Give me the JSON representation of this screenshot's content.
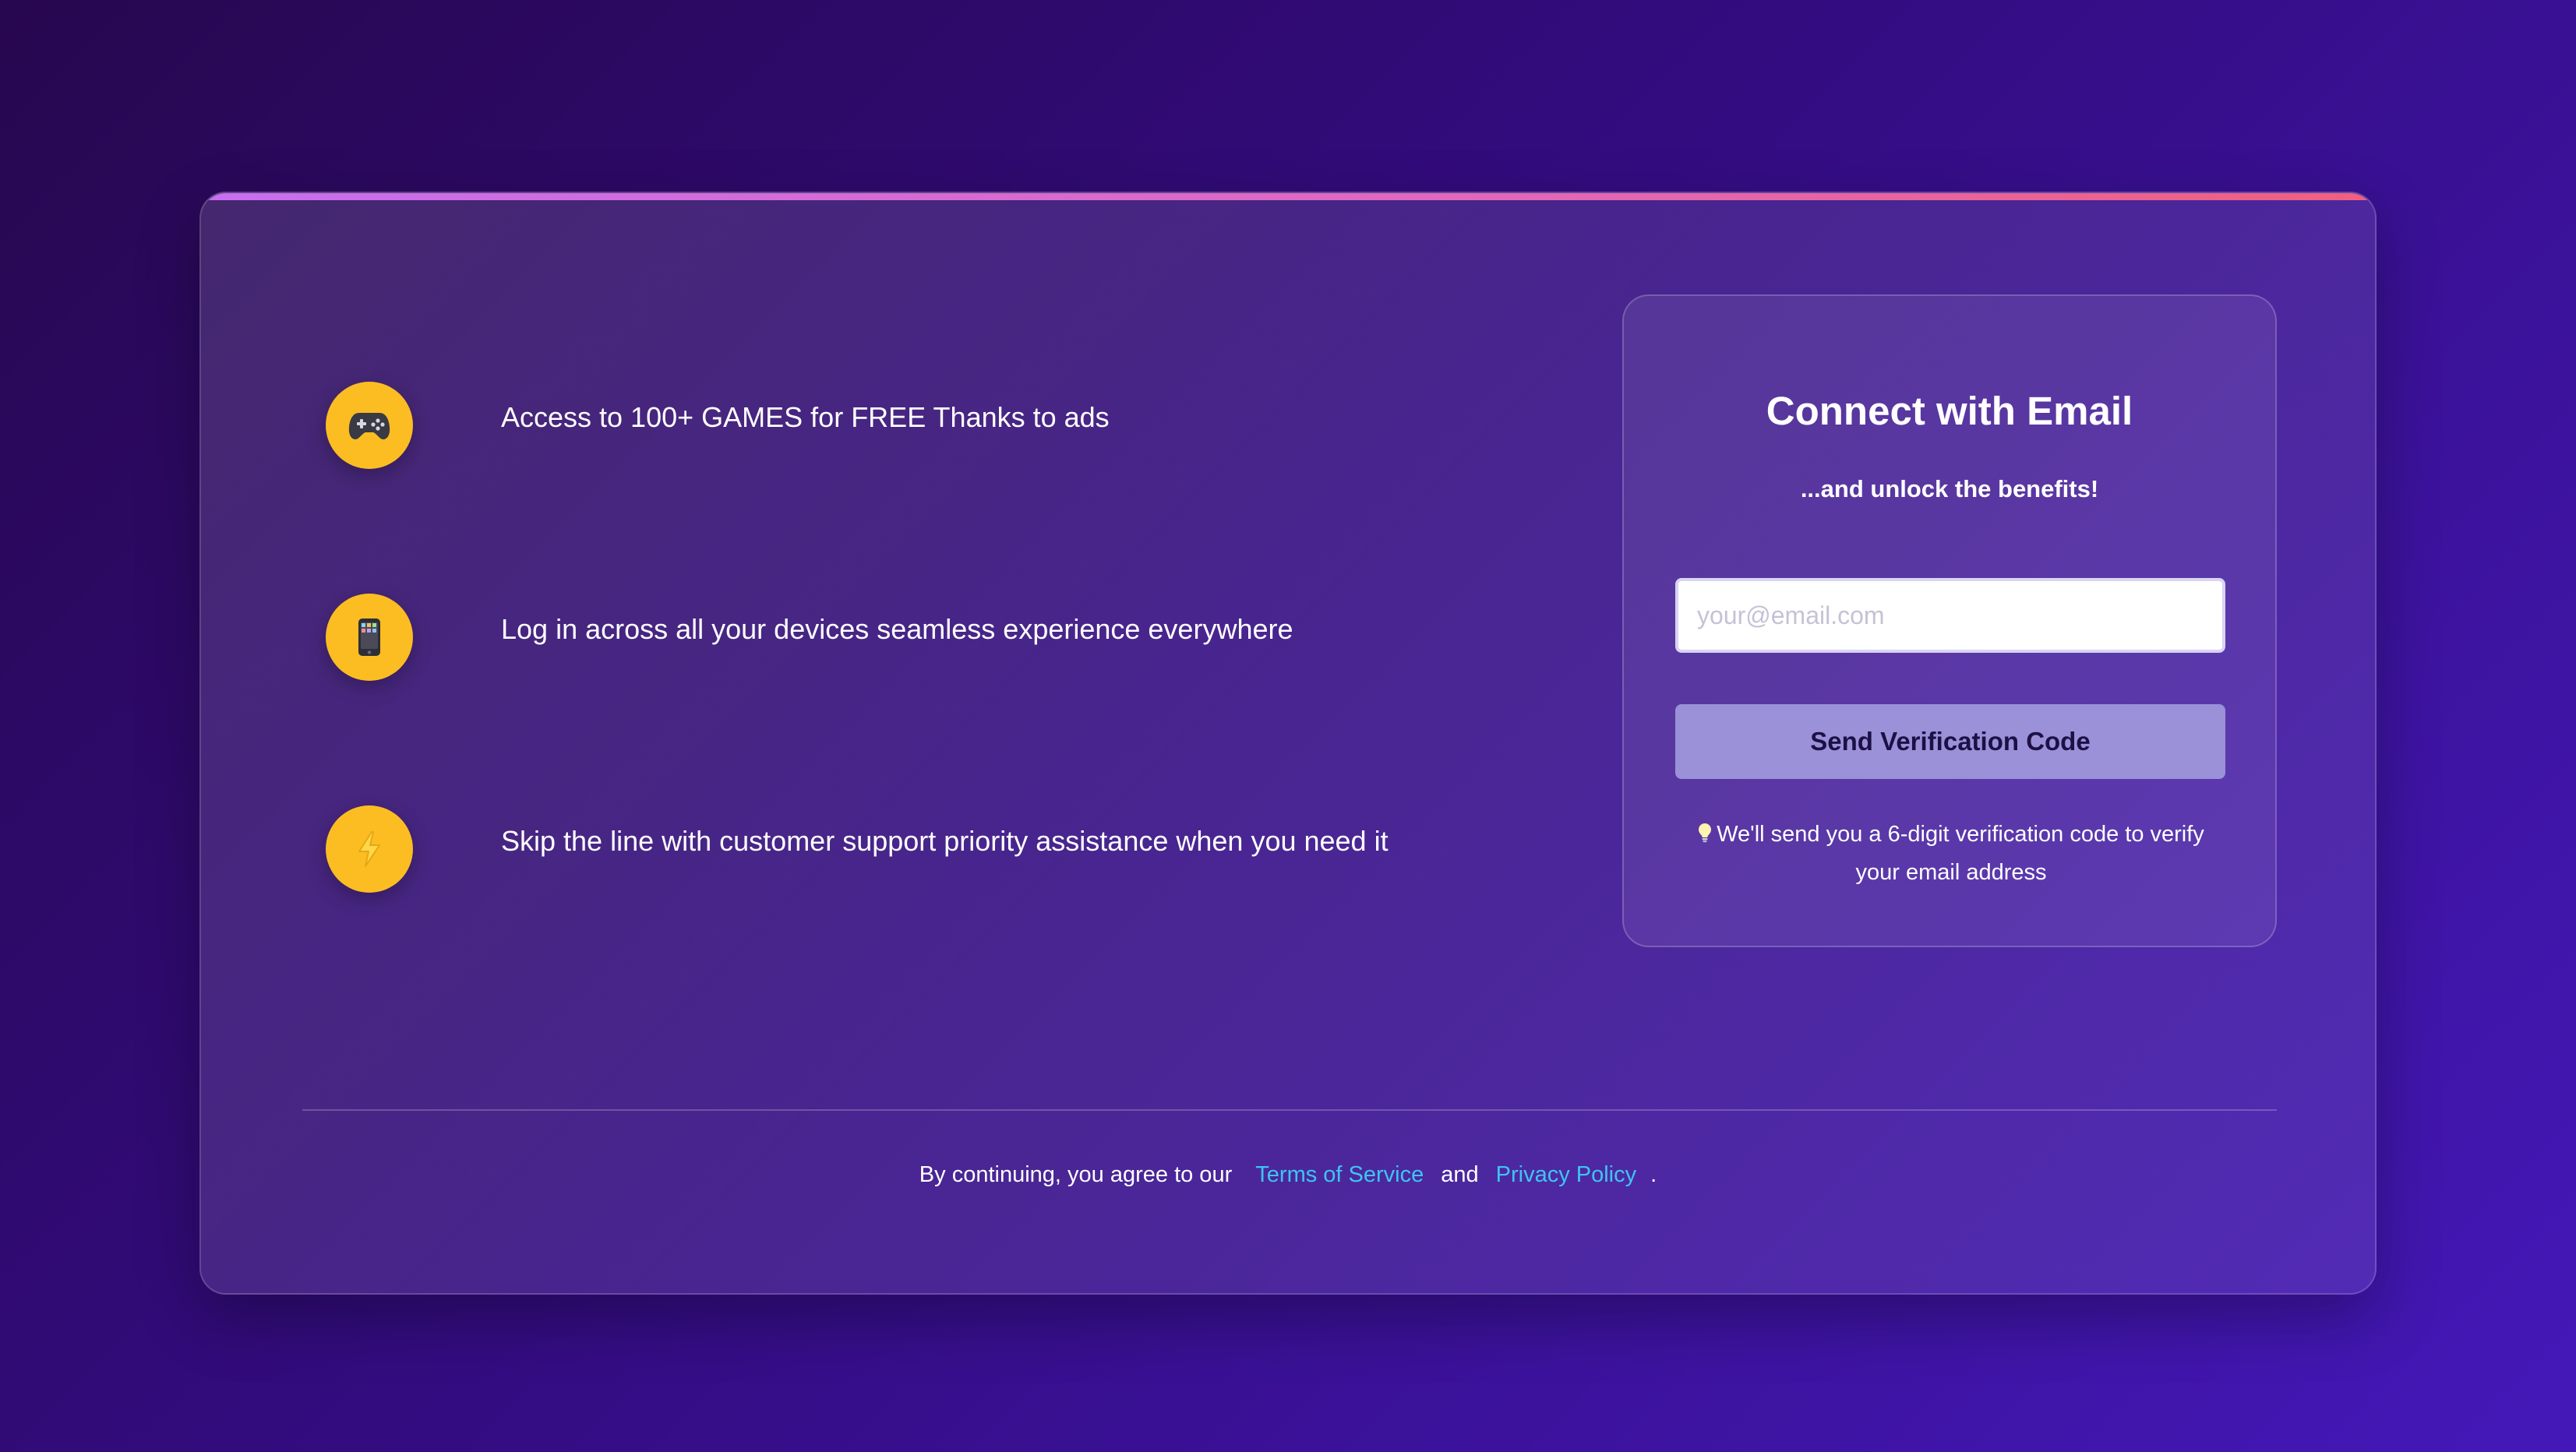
{
  "features": [
    {
      "icon": "gamepad-icon",
      "text": "Access to 100+ GAMES for FREE Thanks to ads"
    },
    {
      "icon": "mobile-phone-icon",
      "text": "Log in across all your devices seamless experience everywhere"
    },
    {
      "icon": "lightning-bolt-icon",
      "text": "Skip the line with customer support priority assistance when you need it"
    }
  ],
  "panel": {
    "title": "Connect with Email",
    "subtitle": "...and unlock the benefits!",
    "email_placeholder": "your@email.com",
    "email_value": "",
    "button_label": "Send Verification Code",
    "note_icon": "lightbulb-icon",
    "note": "We'll send you a 6-digit verification code to verify your email address"
  },
  "footer": {
    "prefix": "By continuing, you agree to our",
    "terms_label": "Terms of Service",
    "and": "and",
    "privacy_label": "Privacy Policy",
    "suffix": "."
  },
  "colors": {
    "background": "#330c80",
    "accent_yellow": "#fbbd22",
    "link": "#3ec4f2",
    "button": "#9a91d8",
    "top_bar_start": "#c76ef0",
    "top_bar_end": "#f0607e"
  }
}
